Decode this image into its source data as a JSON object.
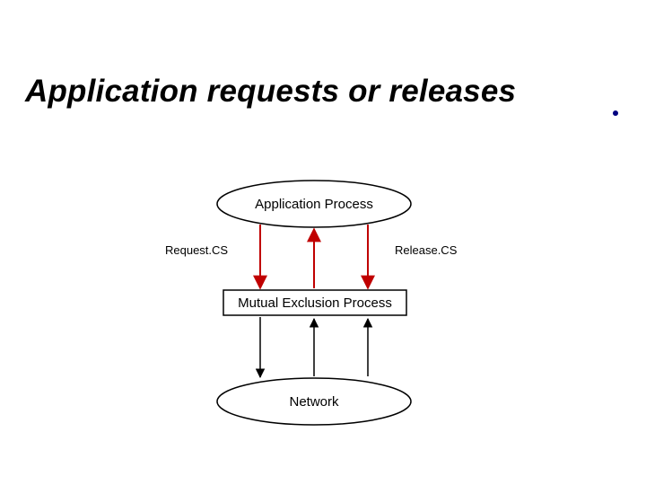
{
  "title": "Application requests or releases",
  "nodes": {
    "application_process": "Application Process",
    "mutual_exclusion_process": "Mutual Exclusion Process",
    "network": "Network"
  },
  "labels": {
    "request_cs": "Request.CS",
    "release_cs": "Release.CS"
  },
  "colors": {
    "accent": "#c00000",
    "border": "#000000"
  }
}
